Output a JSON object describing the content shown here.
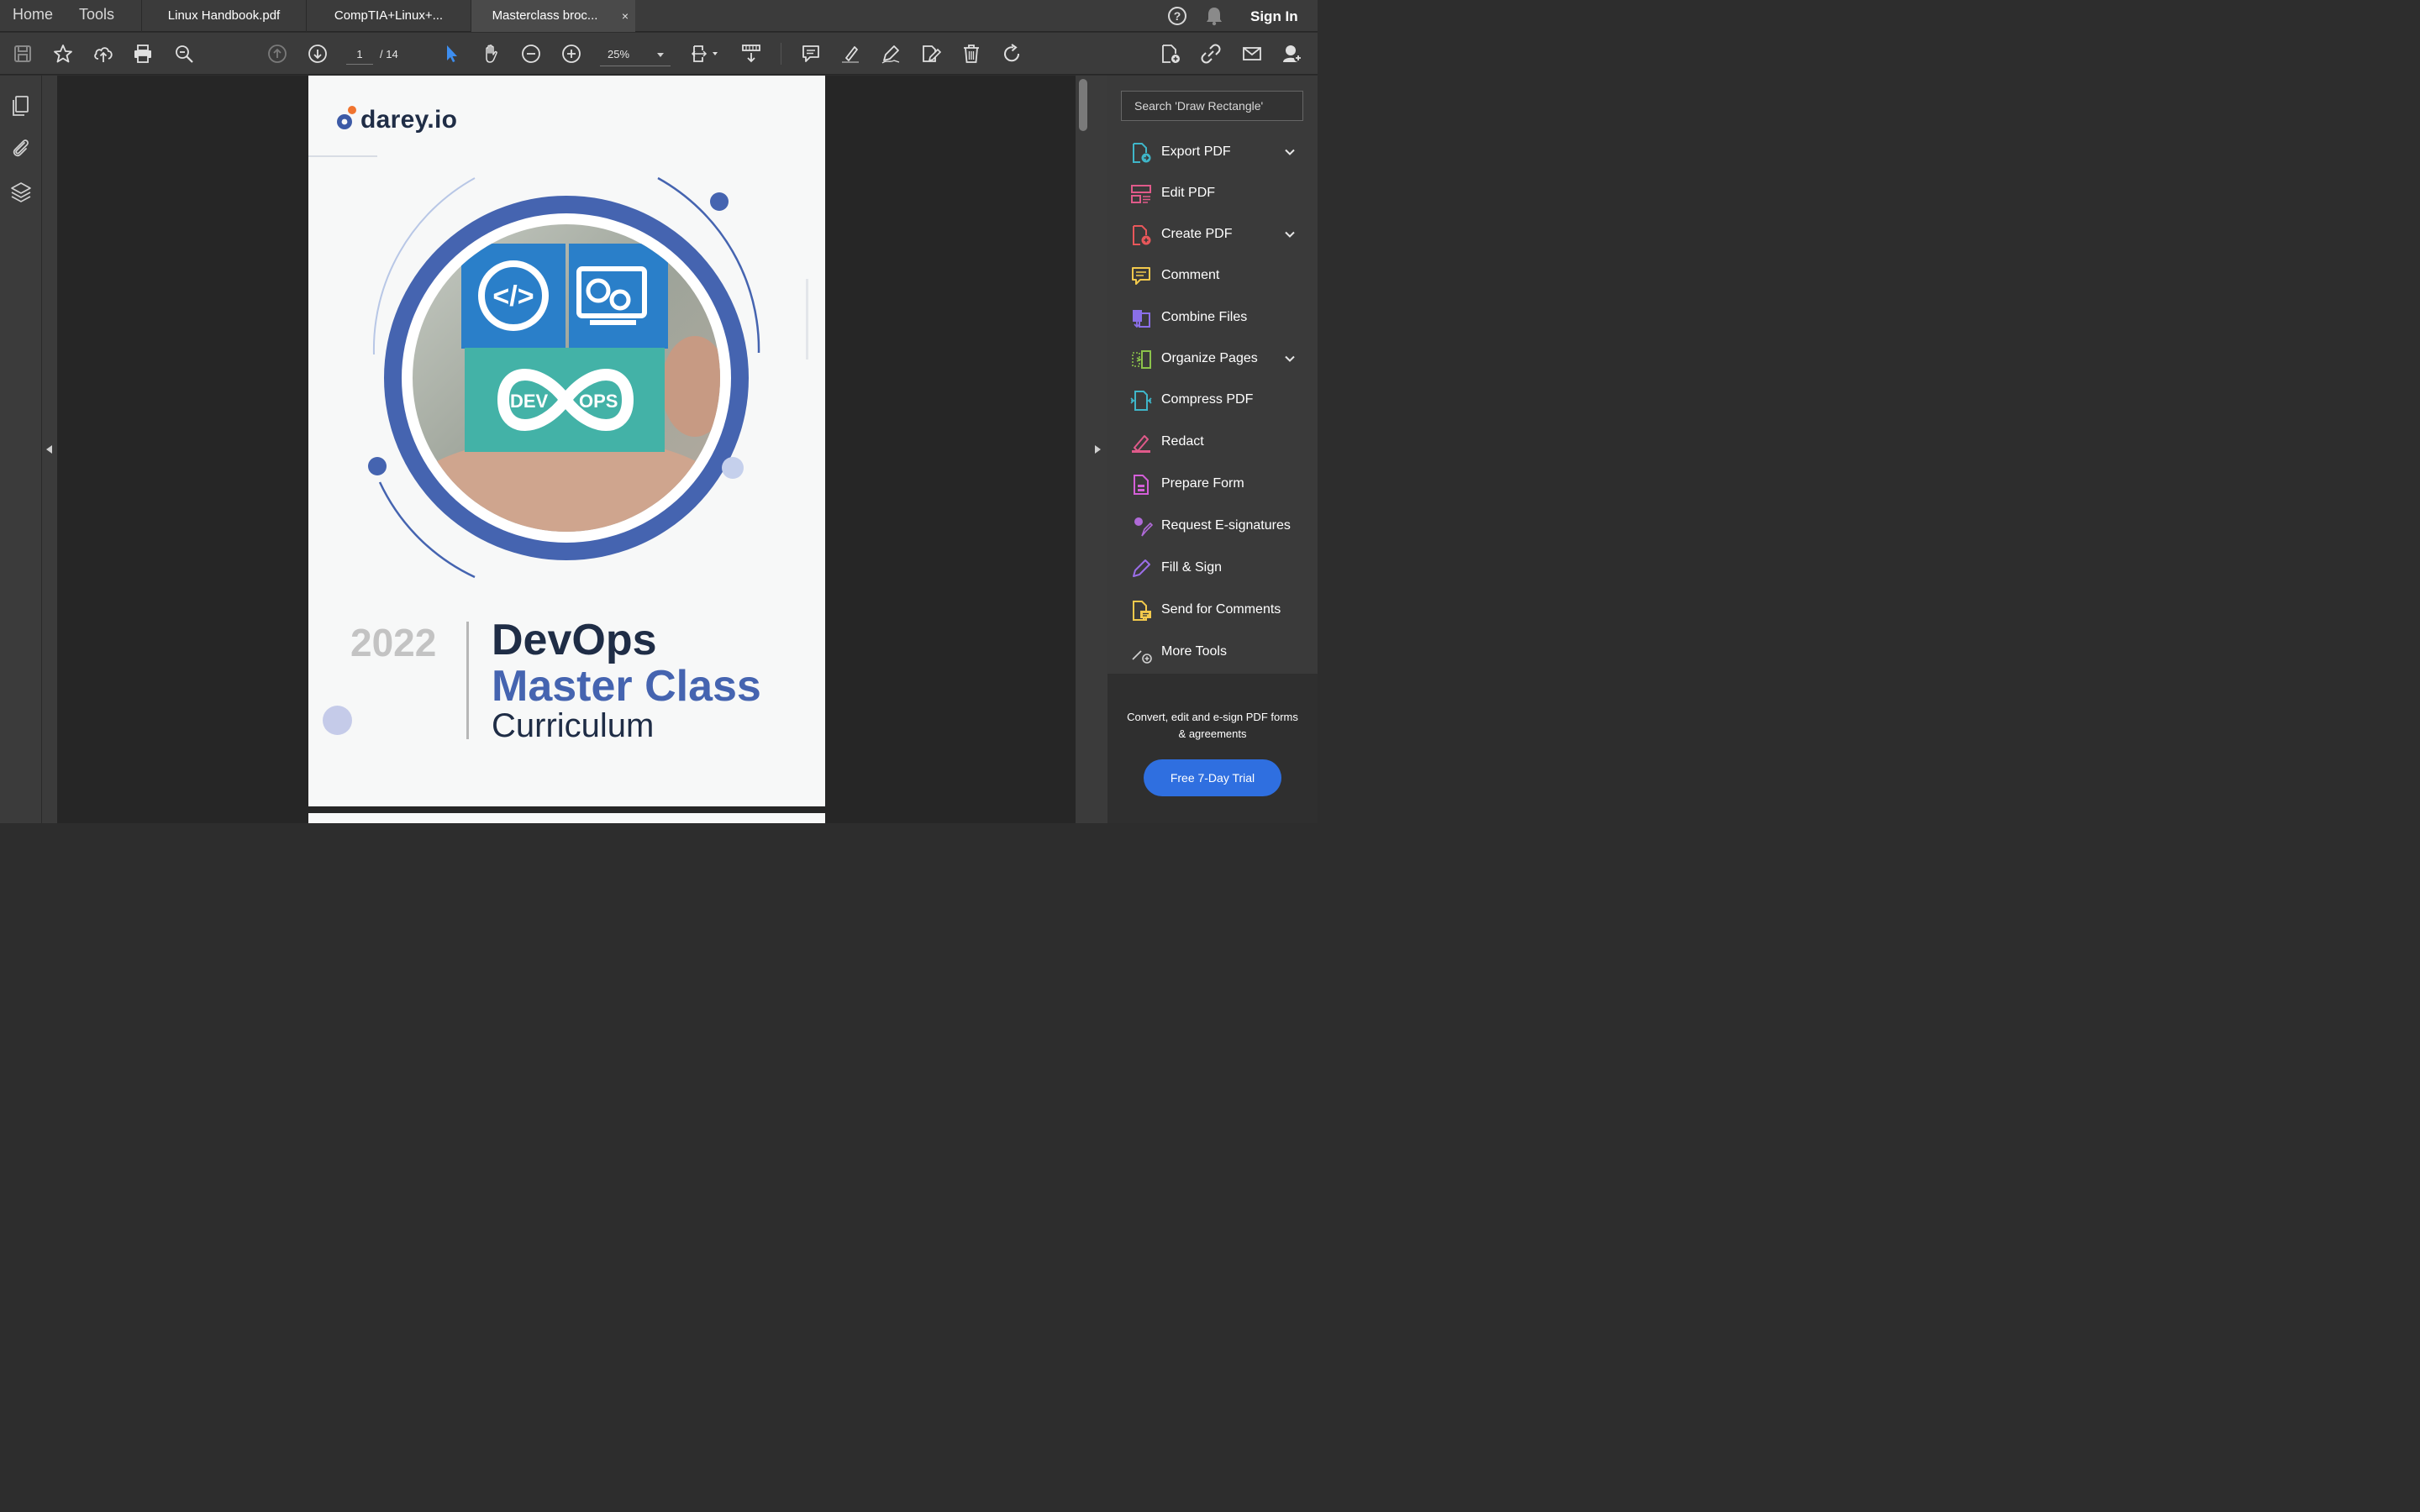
{
  "topbar": {
    "home_label": "Home",
    "tools_label": "Tools",
    "tabs": [
      {
        "label": "Linux Handbook.pdf"
      },
      {
        "label": "CompTIA+Linux+..."
      },
      {
        "label": "Masterclass broc..."
      }
    ],
    "close_symbol": "×",
    "sign_in_label": "Sign In"
  },
  "toolbar": {
    "page_current": "1",
    "page_total": "/ 14",
    "zoom_value": "25%"
  },
  "page": {
    "logo_text": "darey.io",
    "year": "2022",
    "title_line1": "DevOps",
    "title_line2": "Master Class",
    "title_line3": "Curriculum",
    "block_dev": "DEV",
    "block_ops": "OPS"
  },
  "right_panel": {
    "search_placeholder": "Search 'Draw Rectangle'",
    "tools": [
      {
        "label": "Export PDF",
        "icon": "export-pdf-icon",
        "color": "#3fb6c9",
        "expandable": true
      },
      {
        "label": "Edit PDF",
        "icon": "edit-pdf-icon",
        "color": "#e05a8a",
        "expandable": false
      },
      {
        "label": "Create PDF",
        "icon": "create-pdf-icon",
        "color": "#e8575a",
        "expandable": true
      },
      {
        "label": "Comment",
        "icon": "comment-icon",
        "color": "#f2c94c",
        "expandable": false
      },
      {
        "label": "Combine Files",
        "icon": "combine-files-icon",
        "color": "#8a6fe8",
        "expandable": false
      },
      {
        "label": "Organize Pages",
        "icon": "organize-pages-icon",
        "color": "#8bc34a",
        "expandable": true
      },
      {
        "label": "Compress PDF",
        "icon": "compress-pdf-icon",
        "color": "#3fb6c9",
        "expandable": false
      },
      {
        "label": "Redact",
        "icon": "redact-icon",
        "color": "#e05a8a",
        "expandable": false
      },
      {
        "label": "Prepare Form",
        "icon": "prepare-form-icon",
        "color": "#d45fd8",
        "expandable": false
      },
      {
        "label": "Request E-signatures",
        "icon": "request-esignatures-icon",
        "color": "#b06ad8",
        "expandable": false
      },
      {
        "label": "Fill & Sign",
        "icon": "fill-sign-icon",
        "color": "#9b6ee8",
        "expandable": false
      },
      {
        "label": "Send for Comments",
        "icon": "send-for-comments-icon",
        "color": "#f2c94c",
        "expandable": false
      },
      {
        "label": "More Tools",
        "icon": "more-tools-icon",
        "color": "#cfcfcf",
        "expandable": false
      }
    ],
    "promo_text": "Convert, edit and e-sign PDF forms & agreements",
    "trial_button": "Free 7-Day Trial"
  },
  "colors": {
    "accent_blue": "#2f6fe0",
    "brand_navy": "#1f2d46",
    "brand_blue": "#4564b0"
  }
}
